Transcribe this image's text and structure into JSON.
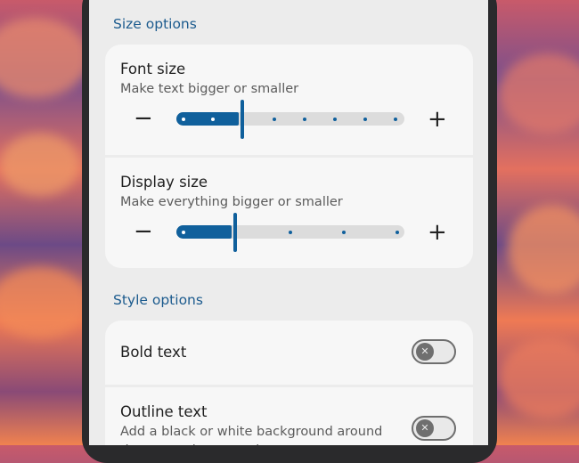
{
  "size_options": {
    "header": "Size options",
    "font_size": {
      "title": "Font size",
      "subtitle": "Make text bigger or smaller",
      "decrease_symbol": "−",
      "increase_symbol": "+",
      "steps": 7,
      "current_step": 2
    },
    "display_size": {
      "title": "Display size",
      "subtitle": "Make everything bigger or smaller",
      "decrease_symbol": "−",
      "increase_symbol": "+",
      "steps": 5,
      "current_step": 1
    }
  },
  "style_options": {
    "header": "Style options",
    "bold_text": {
      "title": "Bold text",
      "enabled": false,
      "toggle_glyph": "✕"
    },
    "outline_text": {
      "title": "Outline text",
      "subtitle": "Add a black or white background around the text to increase the contrast",
      "enabled": false,
      "toggle_glyph": "✕"
    }
  },
  "colors": {
    "accent": "#10609c",
    "section_header": "#1c5b8e",
    "card_bg": "#f7f7f7",
    "screen_bg": "#ececec",
    "track": "#dcdcdc"
  }
}
